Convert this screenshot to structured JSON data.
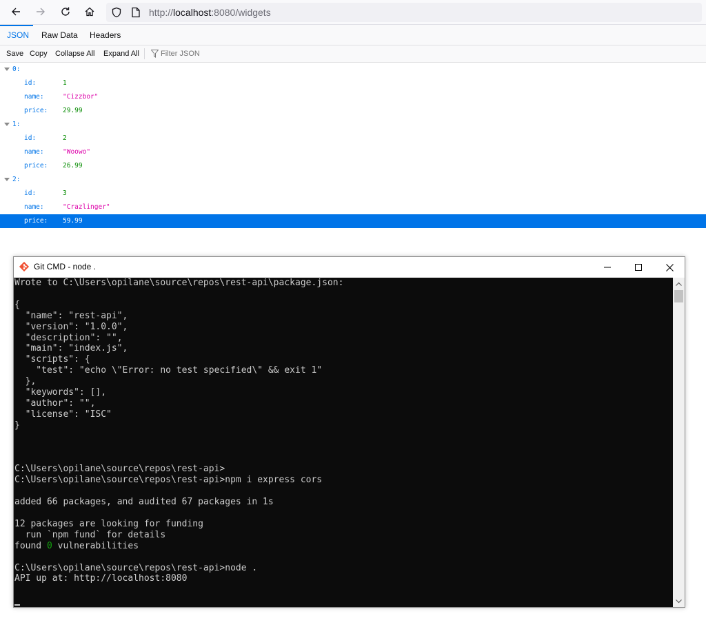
{
  "browser": {
    "url_prefix": "http://",
    "url_host": "localhost",
    "url_rest": ":8080/widgets",
    "icons": [
      "back-icon",
      "forward-icon",
      "reload-icon",
      "home-icon",
      "shield-icon",
      "page-icon"
    ]
  },
  "viewer": {
    "tabs": [
      "JSON",
      "Raw Data",
      "Headers"
    ],
    "active_tab": "JSON",
    "toolbar": {
      "save": "Save",
      "copy": "Copy",
      "collapse_all": "Collapse All",
      "expand_all": "Expand All",
      "filter_placeholder": "Filter JSON"
    },
    "items": [
      {
        "index": "0:",
        "id_key": "id:",
        "id": "1",
        "name_key": "name:",
        "name": "\"Cizzbor\"",
        "price_key": "price:",
        "price": "29.99"
      },
      {
        "index": "1:",
        "id_key": "id:",
        "id": "2",
        "name_key": "name:",
        "name": "\"Woowo\"",
        "price_key": "price:",
        "price": "26.99"
      },
      {
        "index": "2:",
        "id_key": "id:",
        "id": "3",
        "name_key": "name:",
        "name": "\"Crazlinger\"",
        "price_key": "price:",
        "price": "59.99"
      }
    ],
    "selected_row": "2.price"
  },
  "terminal": {
    "title": "Git CMD - node  .",
    "lines_top": "Wrote to C:\\Users\\opilane\\source\\repos\\rest-api\\package.json:\n\n{\n  \"name\": \"rest-api\",\n  \"version\": \"1.0.0\",\n  \"description\": \"\",\n  \"main\": \"index.js\",\n  \"scripts\": {\n    \"test\": \"echo \\\"Error: no test specified\\\" && exit 1\"\n  },\n  \"keywords\": [],\n  \"author\": \"\",\n  \"license\": \"ISC\"\n}\n\n\n\nC:\\Users\\opilane\\source\\repos\\rest-api>\nC:\\Users\\opilane\\source\\repos\\rest-api>npm i express cors\n\nadded 66 packages, and audited 67 packages in 1s\n\n12 packages are looking for funding\n  run `npm fund` for details\n",
    "found_prefix": "found ",
    "found_count": "0",
    "found_suffix": " vulnerabilities",
    "lines_bottom": "\nC:\\Users\\opilane\\source\\repos\\rest-api>node .\nAPI up at: http://localhost:8080",
    "colors": {
      "background": "#0c0c0c",
      "text": "#cccccc",
      "highlight": "#13a10e"
    }
  }
}
